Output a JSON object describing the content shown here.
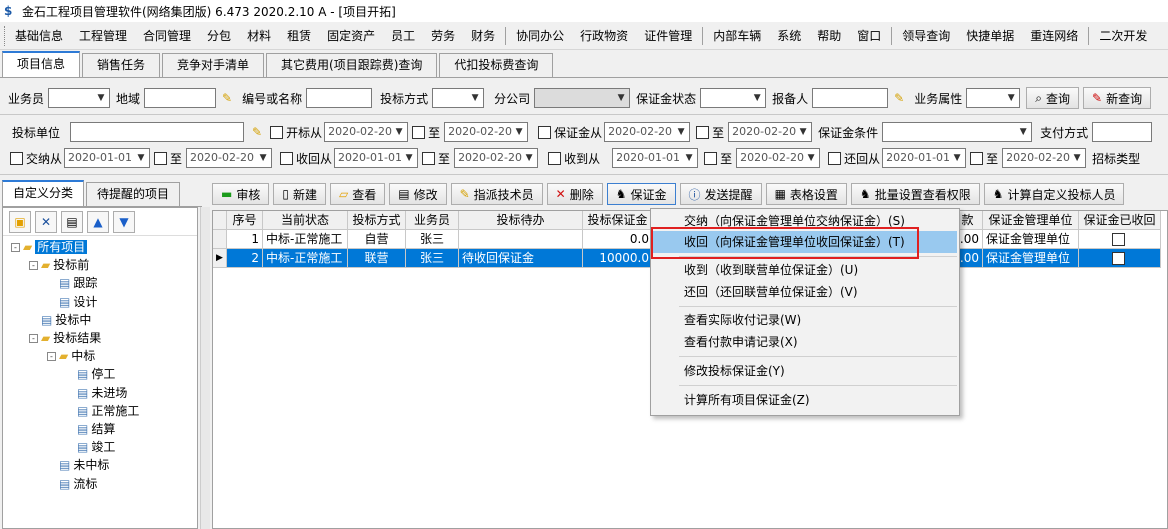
{
  "window": {
    "title": "金石工程项目管理软件(网络集团版) 6.473  2020.2.10 A - [项目开拓]"
  },
  "menu": [
    "基础信息",
    "工程管理",
    "合同管理",
    "分包",
    "材料",
    "租赁",
    "固定资产",
    "员工",
    "劳务",
    "财务",
    "协同办公",
    "行政物资",
    "证件管理",
    "内部车辆",
    "系统",
    "帮助",
    "窗口",
    "领导查询",
    "快捷单据",
    "重连网络",
    "二次开发"
  ],
  "tabs": [
    "项目信息",
    "销售任务",
    "竞争对手清单",
    "其它费用(项目跟踪费)查询",
    "代扣投标费查询"
  ],
  "filters": {
    "row1": {
      "salesman": "业务员",
      "region": "地域",
      "code_name": "编号或名称",
      "bid_method": "投标方式",
      "branch": "分公司",
      "deposit_status": "保证金状态",
      "reporter": "报备人",
      "biz_attr": "业务属性",
      "query": "查询",
      "new_query": "新查询"
    },
    "row2": {
      "bid_unit": "投标单位",
      "open_from": "开标从",
      "to": "至",
      "date_a": "2020-02-20",
      "date_b": "2020-02-20",
      "deposit_from": "保证金从",
      "date_c": "2020-02-20",
      "date_d": "2020-02-20",
      "deposit_cond": "保证金条件",
      "pay_method": "支付方式"
    },
    "row3": {
      "pay_from": "交纳从",
      "date_e": "2020-01-01",
      "date_f": "2020-02-20",
      "recv_from": "收回从",
      "date_g": "2020-01-01",
      "date_h": "2020-02-20",
      "got_from": "收到从",
      "date_i": "2020-01-01",
      "date_j": "2020-02-20",
      "ret_from": "还回从",
      "date_k": "2020-01-01",
      "date_l": "2020-02-20",
      "bid_type": "招标类型"
    }
  },
  "left_tabs": [
    "自定义分类",
    "待提醒的项目"
  ],
  "tree": [
    {
      "label": "所有项目",
      "level": 0,
      "kind": "folder",
      "pm": "-",
      "selected": true
    },
    {
      "label": "投标前",
      "level": 1,
      "kind": "folder",
      "pm": "-"
    },
    {
      "label": "跟踪",
      "level": 2,
      "kind": "doc"
    },
    {
      "label": "设计",
      "level": 2,
      "kind": "doc"
    },
    {
      "label": "投标中",
      "level": 1,
      "kind": "doc"
    },
    {
      "label": "投标结果",
      "level": 1,
      "kind": "folder",
      "pm": "-"
    },
    {
      "label": "中标",
      "level": 2,
      "kind": "folder",
      "pm": "-"
    },
    {
      "label": "停工",
      "level": 3,
      "kind": "doc"
    },
    {
      "label": "未进场",
      "level": 3,
      "kind": "doc"
    },
    {
      "label": "正常施工",
      "level": 3,
      "kind": "doc"
    },
    {
      "label": "结算",
      "level": 3,
      "kind": "doc"
    },
    {
      "label": "竣工",
      "level": 3,
      "kind": "doc"
    },
    {
      "label": "未中标",
      "level": 2,
      "kind": "doc"
    },
    {
      "label": "流标",
      "level": 2,
      "kind": "doc"
    }
  ],
  "toolbar": {
    "audit": "审核",
    "new": "新建",
    "view": "查看",
    "edit": "修改",
    "assign": "指派技术员",
    "delete": "删除",
    "deposit": "保证金",
    "remind": "发送提醒",
    "table_setting": "表格设置",
    "batch_perm": "批量设置查看权限",
    "calc": "计算自定义投标人员"
  },
  "grid": {
    "headers": [
      "序号",
      "当前状态",
      "投标方式",
      "业务员",
      "投标待办",
      "投标保证金",
      "",
      "款",
      "保证金管理单位",
      "保证金已收回"
    ],
    "rows": [
      [
        "1",
        "中标-正常施工",
        "自营",
        "张三",
        "",
        "0.0",
        ".00",
        "保证金管理单位"
      ],
      [
        "2",
        "中标-正常施工",
        "联营",
        "张三",
        "待收回保证金",
        "10000.0",
        ".00",
        "保证金管理单位"
      ]
    ]
  },
  "context_menu": [
    "交纳（向保证金管理单位交纳保证金）(S)",
    "收回（向保证金管理单位收回保证金）(T)",
    "收到（收到联营单位保证金）(U)",
    "还回（还回联营单位保证金）(V)",
    "查看实际收付记录(W)",
    "查看付款申请记录(X)",
    "修改投标保证金(Y)",
    "计算所有项目保证金(Z)"
  ]
}
